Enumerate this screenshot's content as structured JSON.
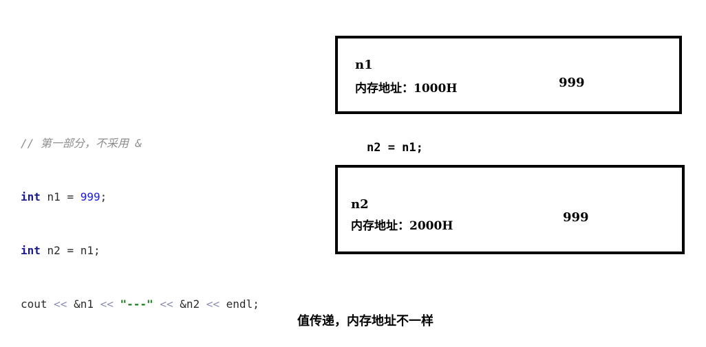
{
  "code": {
    "comment": "// 第一部分，不采用 &",
    "line1": {
      "keyword": "int",
      "rest": " n1 = ",
      "number": "999",
      "end": ";"
    },
    "line2": {
      "keyword": "int",
      "rest": " n2 = n1;"
    },
    "line3": {
      "t1": "cout ",
      "op1": "<<",
      "t2": " &n1 ",
      "op2": "<<",
      "t3": " ",
      "str": "\"---\"",
      "t4": " ",
      "op3": "<<",
      "t5": " &n2 ",
      "op4": "<<",
      "t6": " endl;"
    }
  },
  "box_n1": {
    "name": "n1",
    "address": "内存地址：1000H",
    "value": "999"
  },
  "assignment": "n2 = n1;",
  "box_n2": {
    "name": "n2",
    "address": "内存地址：2000H",
    "value": "999"
  },
  "caption": "值传递，内存地址不一样"
}
